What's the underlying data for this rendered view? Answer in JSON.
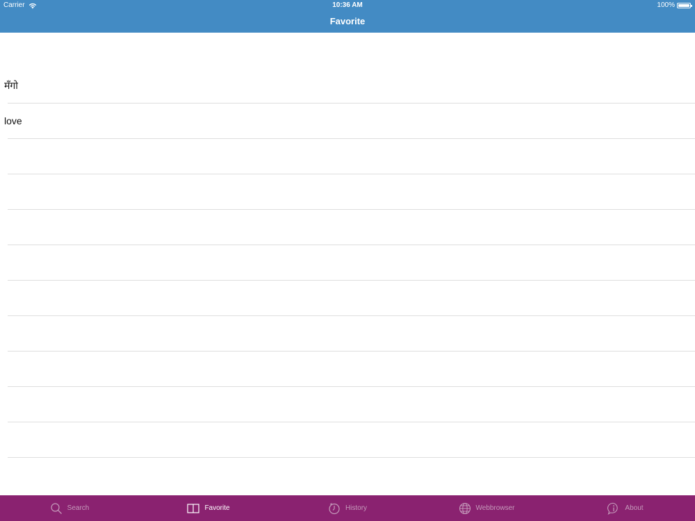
{
  "status_bar": {
    "carrier": "Carrier",
    "time": "10:36 AM",
    "battery": "100%",
    "battery_level": 1.0
  },
  "nav": {
    "title": "Favorite"
  },
  "favorites": [
    {
      "label": "मँगो"
    },
    {
      "label": "love"
    }
  ],
  "empty_rows": 9,
  "tabs": [
    {
      "id": "search",
      "label": "Search",
      "icon": "search-icon",
      "active": false
    },
    {
      "id": "favorite",
      "label": "Favorite",
      "icon": "book-icon",
      "active": true
    },
    {
      "id": "history",
      "label": "History",
      "icon": "clock-icon",
      "active": false
    },
    {
      "id": "webbrowser",
      "label": "Webbrowser",
      "icon": "globe-icon",
      "active": false
    },
    {
      "id": "about",
      "label": "About",
      "icon": "info-icon",
      "active": false
    }
  ],
  "colors": {
    "nav_bar": "#438bc4",
    "tab_bar": "#8a2270",
    "tab_inactive": "#c59bbb",
    "tab_active": "#ffffff",
    "separator": "#dedede"
  }
}
